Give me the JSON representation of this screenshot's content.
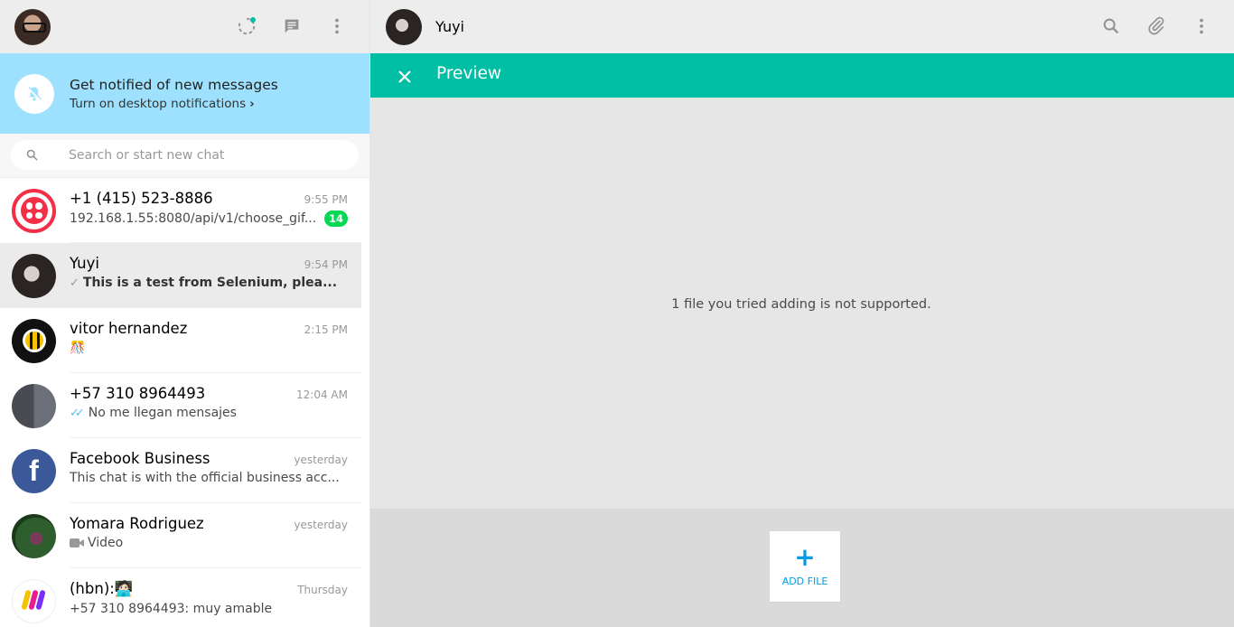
{
  "left_header": {
    "icons": [
      "status-icon",
      "new-chat-icon",
      "menu-icon"
    ]
  },
  "notification": {
    "title": "Get notified of new messages",
    "subtitle": "Turn on desktop notifications",
    "chevron": "›"
  },
  "search": {
    "placeholder": "Search or start new chat"
  },
  "chats": [
    {
      "name": "+1 (415) 523-8886",
      "time": "9:55 PM",
      "message": "192.168.1.55:8080/api/v1/choose_gif...",
      "badge": "14"
    },
    {
      "name": "Yuyi",
      "time": "9:54 PM",
      "tick": "✓",
      "message": "This is a test from Selenium, plea...",
      "active": true
    },
    {
      "name": "vitor hernandez",
      "time": "2:15 PM",
      "message": "🎊"
    },
    {
      "name": "+57 310 8964493",
      "time": "12:04 AM",
      "tick": "✓✓",
      "message": "No me llegan mensajes"
    },
    {
      "name": "Facebook Business",
      "time": "yesterday",
      "message": "This chat is with the official business acc..."
    },
    {
      "name": "Yomara Rodriguez",
      "time": "yesterday",
      "message": "Video"
    },
    {
      "name": "(hbn):🧑🏻‍💻",
      "time": "Thursday",
      "message": "+57 310 8964493: muy amable"
    }
  ],
  "conversation": {
    "contact_name": "Yuyi"
  },
  "preview": {
    "title": "Preview",
    "message": "1 file you tried adding is not supported.",
    "add_file_plus": "+",
    "add_file_label": "ADD FILE"
  },
  "colors": {
    "teal": "#00bfa5",
    "notif_bg": "#9de1fe",
    "badge_green": "#06d755",
    "add_blue": "#039be5"
  }
}
